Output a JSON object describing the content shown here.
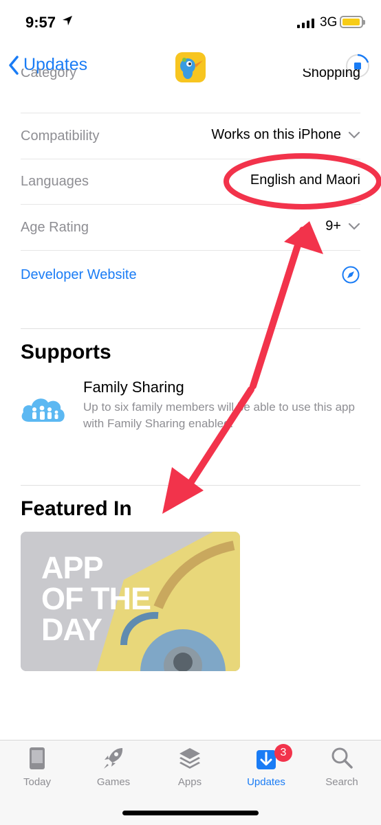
{
  "status_bar": {
    "time": "9:57",
    "network": "3G"
  },
  "nav": {
    "back_label": "Updates"
  },
  "info": {
    "rows": [
      {
        "label": "Category",
        "value": "Shopping"
      },
      {
        "label": "Compatibility",
        "value": "Works on this iPhone"
      },
      {
        "label": "Languages",
        "value": "English and Maori"
      },
      {
        "label": "Age Rating",
        "value": "9+"
      }
    ],
    "developer_website": "Developer Website"
  },
  "supports": {
    "title": "Supports",
    "family_sharing_title": "Family Sharing",
    "family_sharing_desc": "Up to six family members will be able to use this app with Family Sharing enabled."
  },
  "featured": {
    "title": "Featured In",
    "card_text": [
      "APP",
      "OF THE",
      "DAY"
    ]
  },
  "tabs": [
    {
      "label": "Today",
      "icon": "today-icon"
    },
    {
      "label": "Games",
      "icon": "rocket-icon"
    },
    {
      "label": "Apps",
      "icon": "layers-icon"
    },
    {
      "label": "Updates",
      "icon": "download-icon",
      "active": true,
      "badge": "3"
    },
    {
      "label": "Search",
      "icon": "search-icon"
    }
  ],
  "colors": {
    "accent": "#1a7cf5",
    "annotation": "#f2334b",
    "badge": "#f2334b"
  }
}
